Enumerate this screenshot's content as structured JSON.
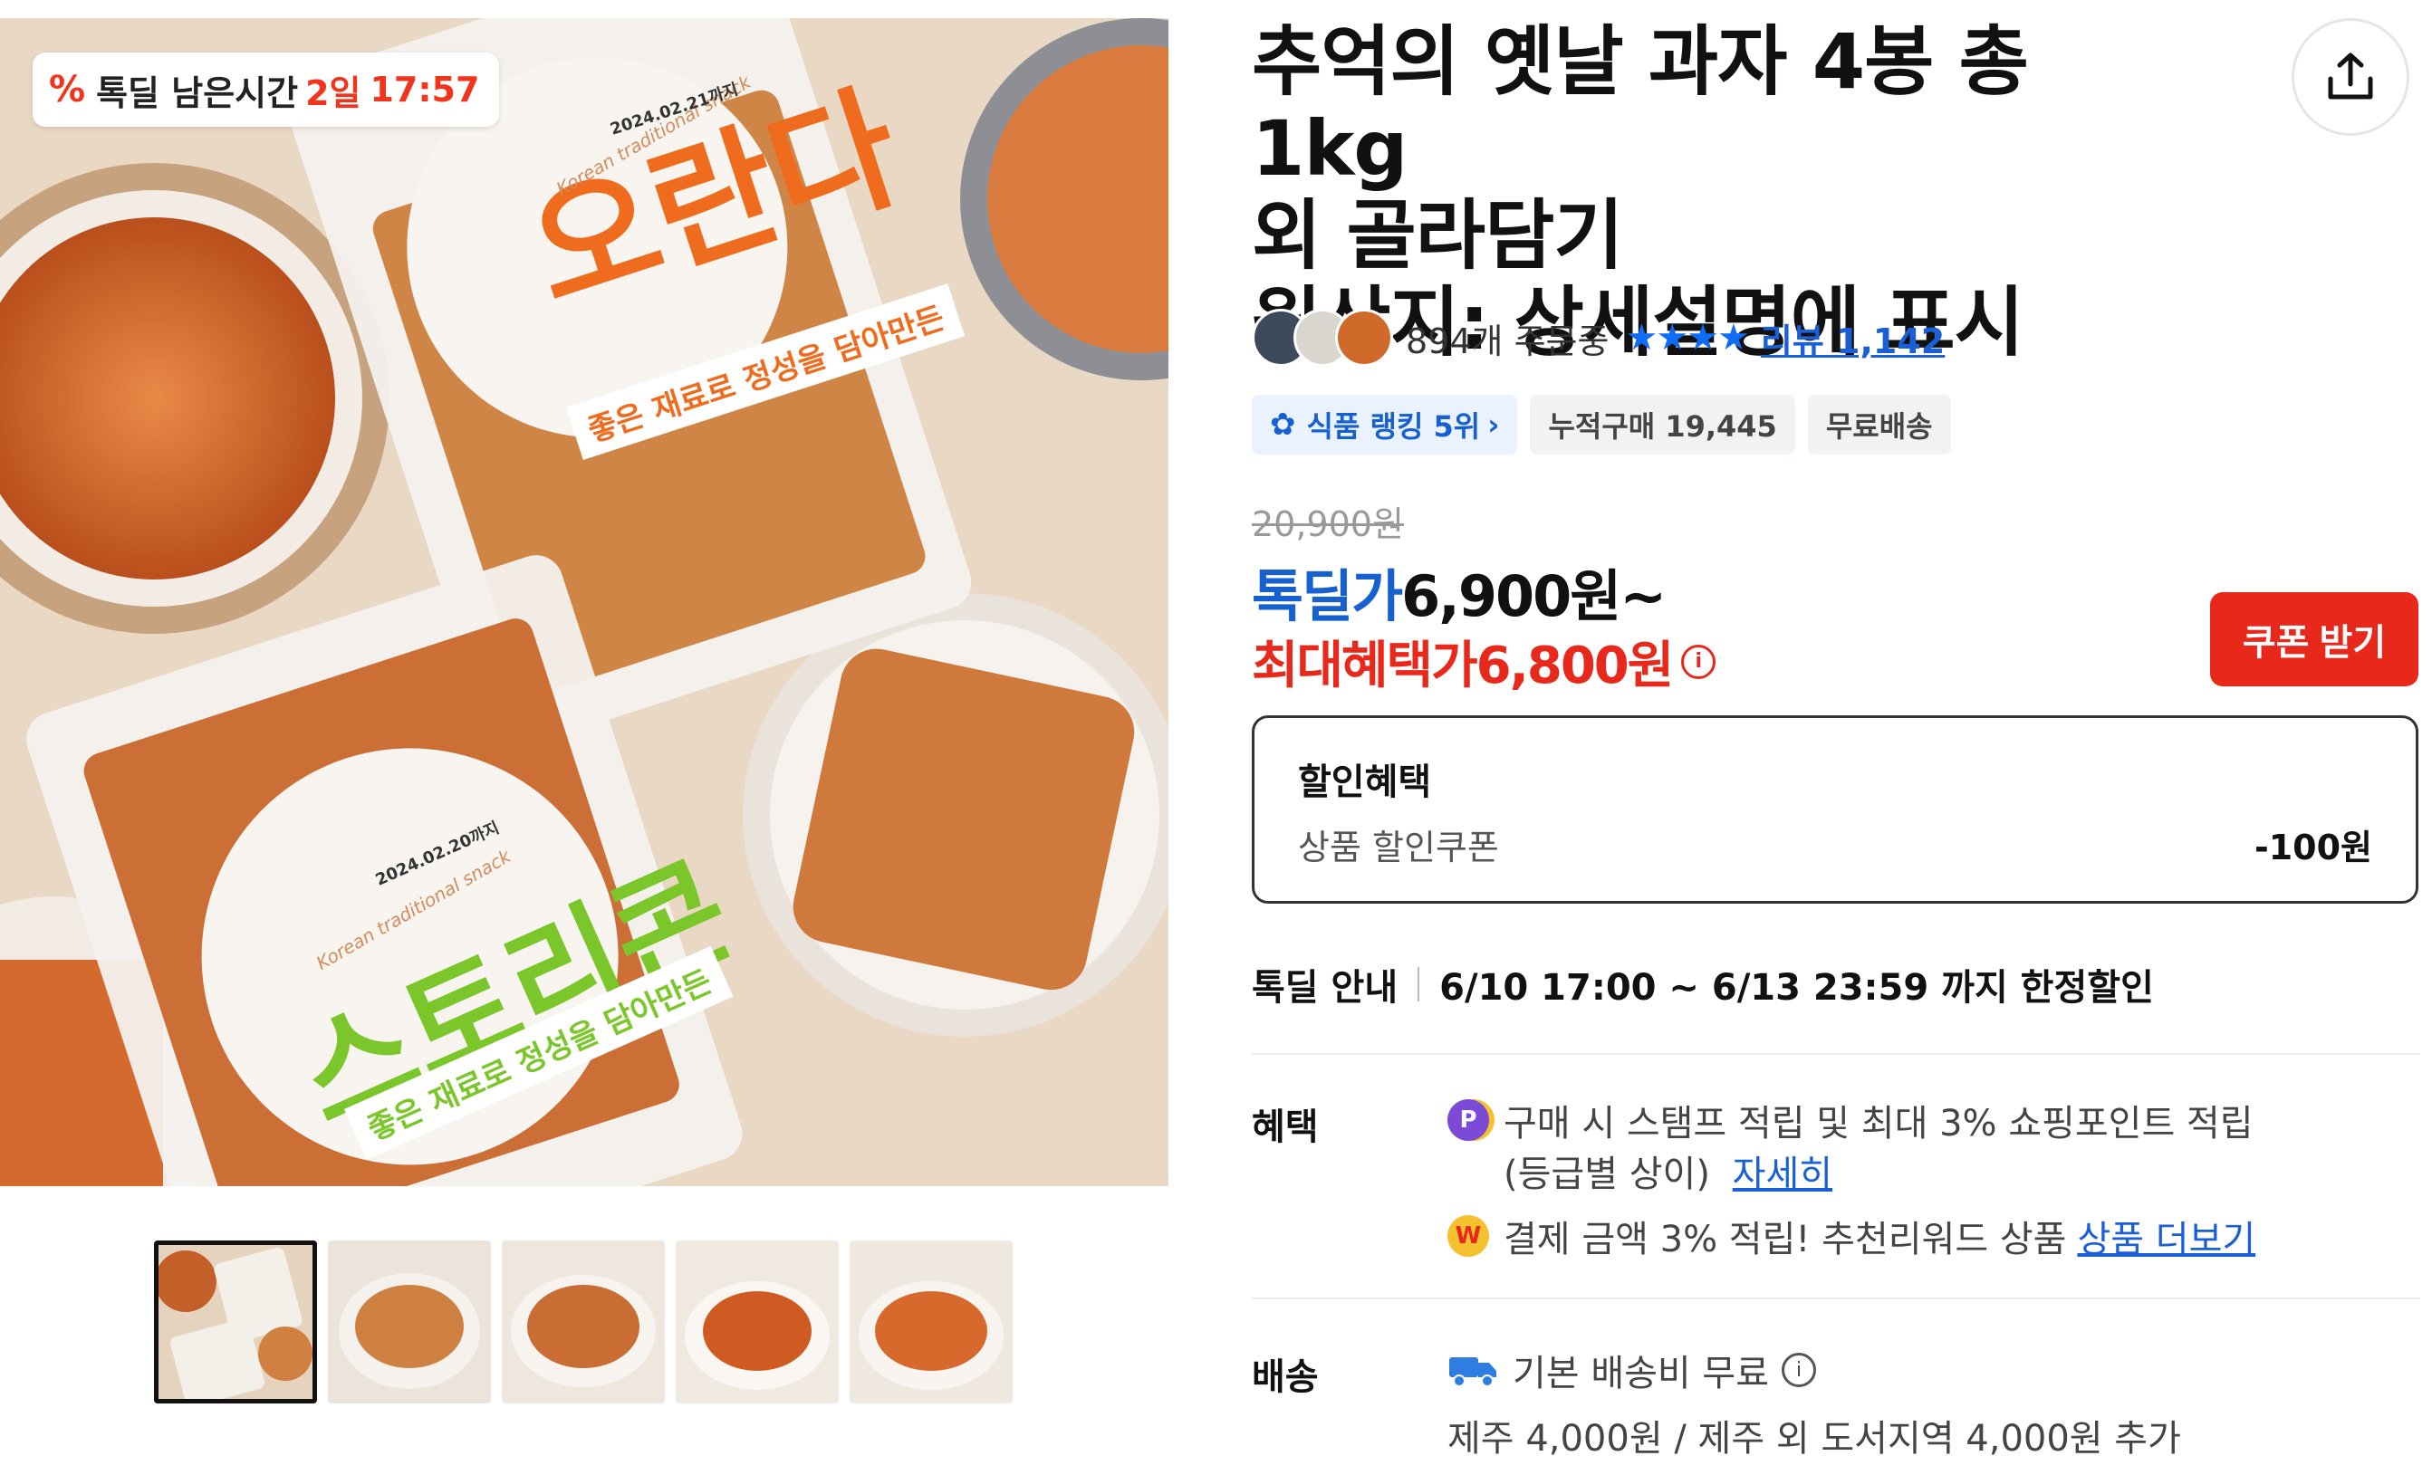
{
  "timer_badge": {
    "label": "톡딜 남은시간",
    "remaining_days": "2일",
    "remaining_time": "17:57"
  },
  "image_text": {
    "bag1_brand": "오란다",
    "bag1_slogan": "좋은 재료로 정성을 담아만든",
    "bag1_date": "2024.02.21까지",
    "bag1_script": "Korean traditional snack",
    "bag2_brand": "스토리콘",
    "bag2_slogan": "좋은 재료로 정성을 담아만든",
    "bag2_date": "2024.02.20까지",
    "bag2_script": "Korean traditional snack"
  },
  "thumbnails": {
    "count": 5,
    "selected_index": 0
  },
  "product": {
    "title_line1": "추억의 옛날 과자 4봉 총 1kg",
    "title_line2": "외 골라담기",
    "title_line3": "원산지: 상세설명에 표시"
  },
  "stats": {
    "orders": "894개 주문중",
    "stars": "★★★★",
    "review_label": "리뷰 1,142",
    "rating_stars": 4
  },
  "badges": {
    "rank": "식품 랭킹 5위",
    "cumulative": "누적구매 19,445",
    "shipping": "무료배송"
  },
  "price": {
    "original": "20,900원",
    "deal_label": "톡딜가",
    "deal_amount": "6,900원~",
    "max_benefit_label": "최대혜택가",
    "max_benefit_amount": "6,800원",
    "coupon_button": "쿠폰 받기"
  },
  "discount": {
    "header": "할인혜택",
    "item_label": "상품 할인쿠폰",
    "item_value": "-100원"
  },
  "deal_guide": {
    "label": "톡딜 안내",
    "period": "6/10 17:00 ~ 6/13 23:59 까지 한정할인"
  },
  "benefit": {
    "label": "혜택",
    "line1": "구매 시 스탬프 적립 및 최대 3% 쇼핑포인트 적립",
    "line1b": "(등급별 상이)",
    "line1_link": "자세히",
    "line2": "결제 금액 3% 적립! 추천리워드 상품",
    "line2_link": "상품 더보기",
    "p_icon": "P",
    "w_icon": "W"
  },
  "shipping": {
    "label": "배송",
    "line1": "기본 배송비 무료",
    "line2": "제주 4,000원 / 제주 외 도서지역 4,000원 추가"
  },
  "icons": {
    "share": "share-upload-icon",
    "info": "info-icon",
    "truck": "truck-icon",
    "gear": "rank-gear-icon",
    "chevron": "chevron-right-icon"
  },
  "colors": {
    "deal_blue": "#1660cf",
    "accent_red": "#e8281a",
    "link_blue": "#1a5fd6",
    "star_blue": "#0f6df5"
  }
}
